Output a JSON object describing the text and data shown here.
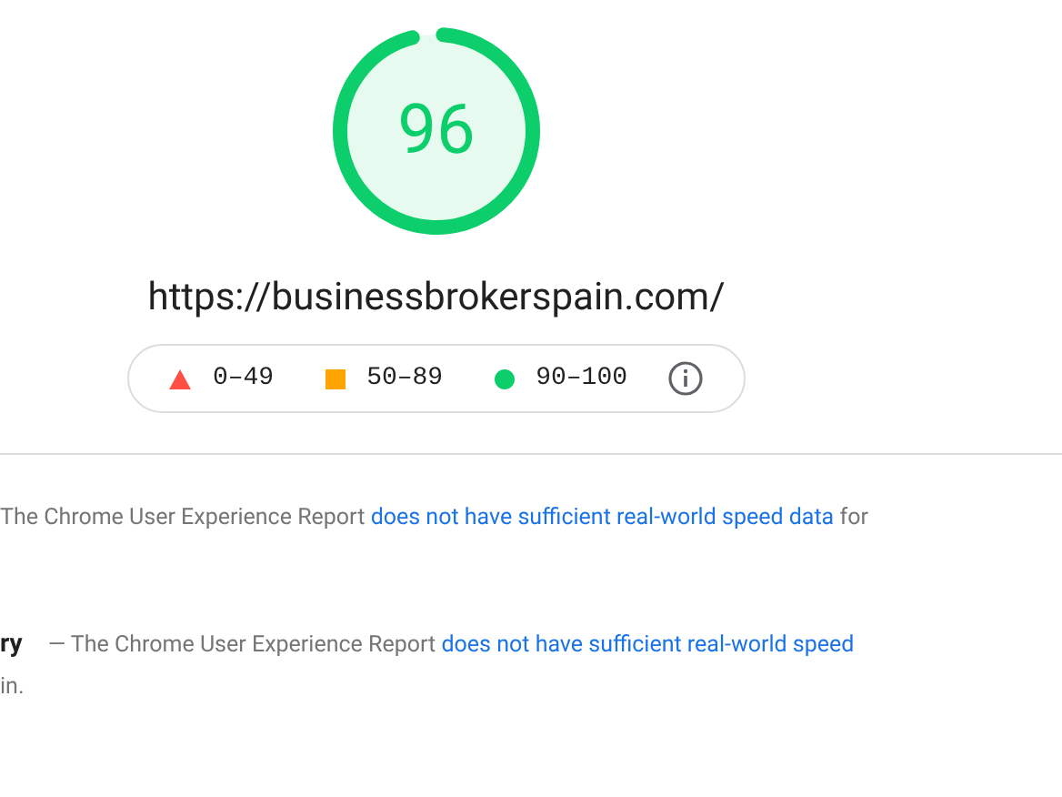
{
  "gauge": {
    "score": "96",
    "level": 0.96,
    "color": "#0cce6b"
  },
  "url": "https://businessbrokerspain.com/",
  "legend": {
    "items": [
      {
        "kind": "triangle",
        "label": "0–49",
        "color": "#ff4e42"
      },
      {
        "kind": "square",
        "label": "50–89",
        "color": "#ffa400"
      },
      {
        "kind": "circle",
        "label": "90–100",
        "color": "#0cce6b"
      }
    ]
  },
  "sections": [
    {
      "text": "The Chrome User Experience Report",
      "link": "does not have sufficient real-world speed data",
      "tail": " for"
    },
    {
      "heading": "ry",
      "text": "— The Chrome User Experience Report",
      "link": "does not have sufficient real-world speed",
      "continuation": "in."
    }
  ]
}
